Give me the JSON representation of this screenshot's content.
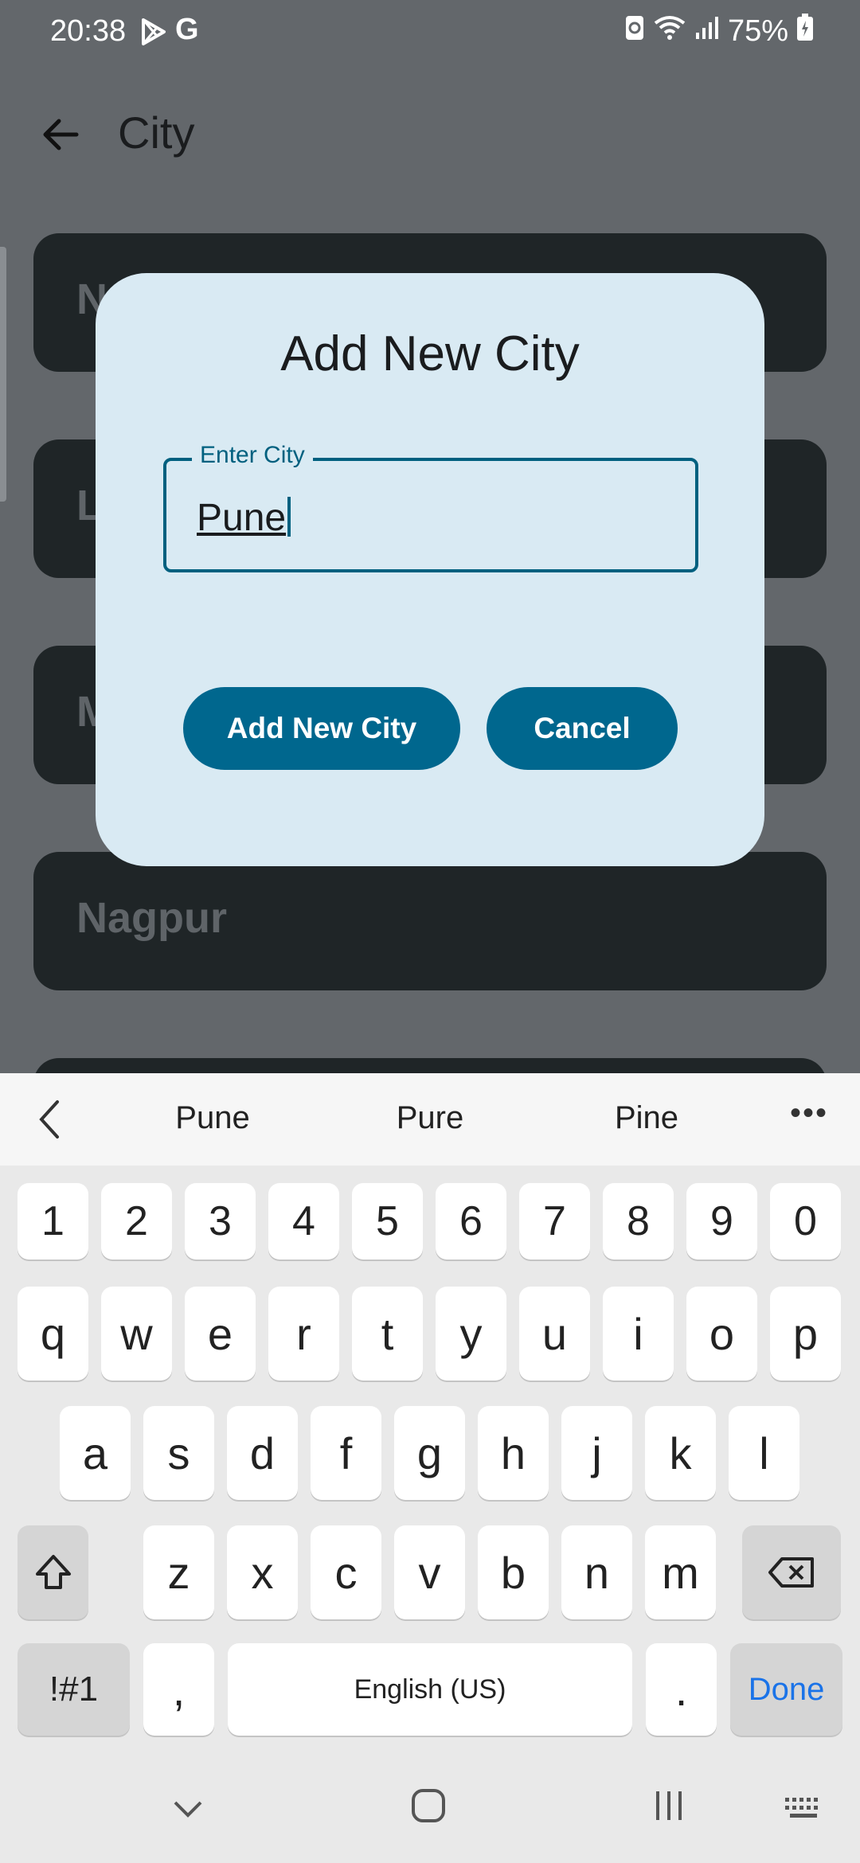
{
  "status_bar": {
    "time": "20:38",
    "google_letter": "G",
    "battery": "75%"
  },
  "app_bar": {
    "title": "City"
  },
  "city_list": [
    "N",
    "L",
    "M",
    "Nagpur"
  ],
  "dialog": {
    "title": "Add New City",
    "field_label": "Enter City",
    "field_value": "Pune",
    "add_button": "Add New City",
    "cancel_button": "Cancel"
  },
  "keyboard": {
    "suggestions": [
      "Pune",
      "Pure",
      "Pine"
    ],
    "number_row": [
      "1",
      "2",
      "3",
      "4",
      "5",
      "6",
      "7",
      "8",
      "9",
      "0"
    ],
    "row1": [
      "q",
      "w",
      "e",
      "r",
      "t",
      "y",
      "u",
      "i",
      "o",
      "p"
    ],
    "row2": [
      "a",
      "s",
      "d",
      "f",
      "g",
      "h",
      "j",
      "k",
      "l"
    ],
    "row3": [
      "z",
      "x",
      "c",
      "v",
      "b",
      "n",
      "m"
    ],
    "symbols_key": "!#1",
    "comma_key": ",",
    "space_label": "English (US)",
    "period_key": ".",
    "done_key": "Done"
  }
}
